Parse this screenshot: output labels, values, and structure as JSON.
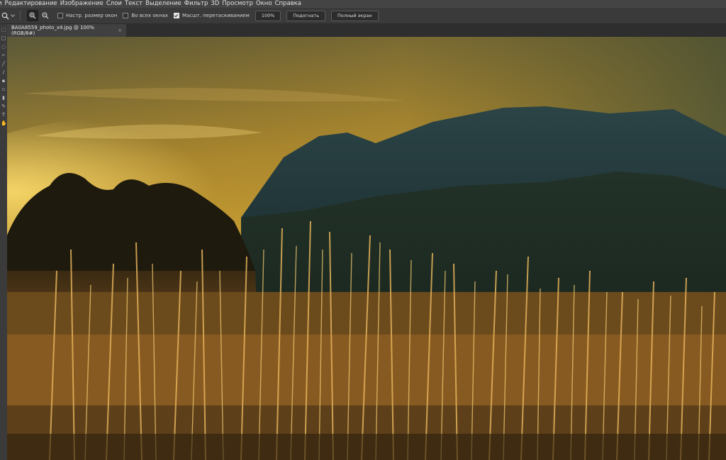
{
  "menu": {
    "items": [
      "и",
      "Редактирование",
      "Изображение",
      "Слои",
      "Текст",
      "Выделение",
      "Фильтр",
      "3D",
      "Просмотр",
      "Окно",
      "Справка"
    ]
  },
  "options": {
    "checkbox_resize": "Настр. размер окон",
    "checkbox_all_windows": "Во всех окнах",
    "checkbox_scrubby": "Масшт. перетаскиванием",
    "zoom_value": "100%",
    "fit_button": "Подогнать",
    "fullscreen_button": "Полный экран"
  },
  "document": {
    "tab_title": "BA0A8559_photo_x4.jpg @ 100% (RGB/8#)",
    "close_glyph": "×"
  },
  "colors": {
    "accent_sky_top": "#5b5a3c",
    "accent_sky_glow": "#f6c43c",
    "mountain": "#1f3436",
    "grass": "#c98a2a"
  },
  "icons": {
    "zoom_tool": "magnifier-icon",
    "zoom_in": "zoom-in-icon",
    "zoom_out": "zoom-out-icon"
  }
}
